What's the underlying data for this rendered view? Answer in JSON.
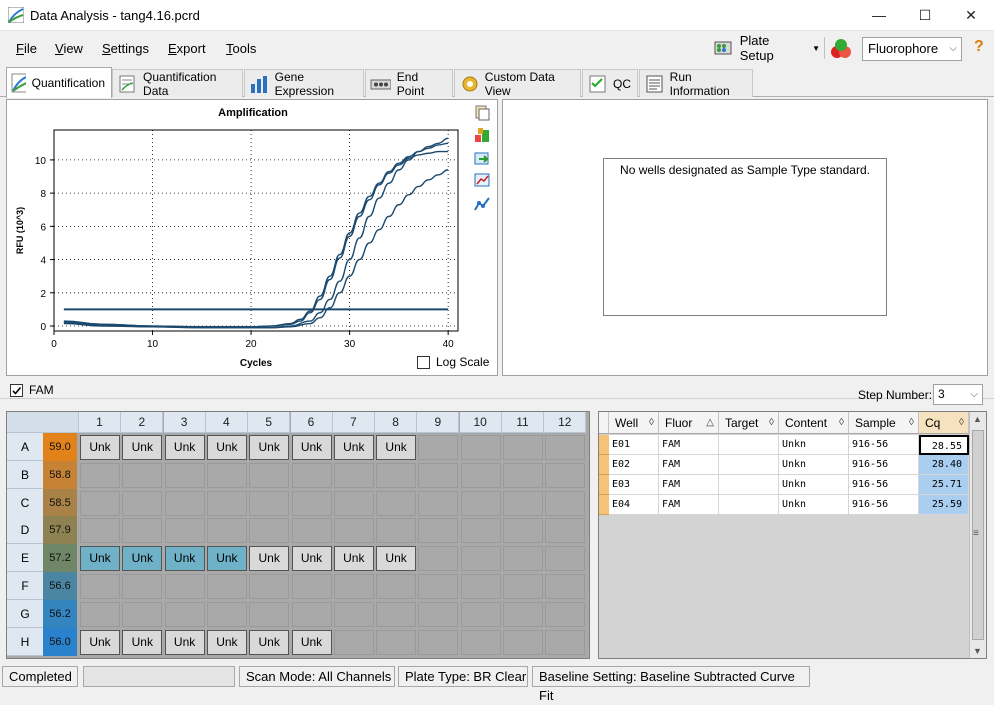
{
  "window": {
    "title": "Data Analysis - tang4.16.pcrd",
    "minimize": "—",
    "maximize": "☐",
    "close": "✕"
  },
  "menu": {
    "file": "File",
    "view": "View",
    "settings": "Settings",
    "export": "Export",
    "tools": "Tools"
  },
  "toolbar": {
    "plate_setup": "Plate Setup",
    "fluorophore": "Fluorophore",
    "help": "?"
  },
  "tabs": [
    "Quantification",
    "Quantification Data",
    "Gene Expression",
    "End Point",
    "Custom Data View",
    "QC",
    "Run Information"
  ],
  "chart_data": {
    "type": "line",
    "title": "Amplification",
    "xlabel": "Cycles",
    "ylabel": "RFU (10^3)",
    "xlim": [
      0,
      41
    ],
    "ylim": [
      -0.3,
      11.8
    ],
    "xticks": [
      0,
      10,
      20,
      30,
      40
    ],
    "yticks": [
      0,
      2,
      4,
      6,
      8,
      10
    ],
    "grid": true,
    "threshold": 1.0,
    "series": [
      {
        "x": [
          1,
          5,
          10,
          15,
          20,
          22,
          24,
          25,
          26,
          27,
          28,
          29,
          30,
          31,
          32,
          33,
          34,
          35,
          36,
          37,
          38,
          39,
          40
        ],
        "y": [
          0.3,
          0.1,
          0.0,
          -0.05,
          -0.05,
          0.0,
          0.15,
          0.4,
          0.9,
          1.8,
          3.0,
          4.3,
          5.6,
          6.8,
          7.8,
          8.6,
          9.3,
          9.8,
          10.2,
          10.5,
          10.7,
          10.9,
          11.0
        ]
      },
      {
        "x": [
          1,
          5,
          10,
          15,
          20,
          22,
          24,
          25,
          26,
          27,
          28,
          29,
          30,
          31,
          32,
          33,
          34,
          35,
          36,
          37,
          38,
          39,
          40
        ],
        "y": [
          0.25,
          0.1,
          0.0,
          -0.05,
          -0.05,
          0.0,
          0.1,
          0.3,
          0.8,
          1.6,
          2.8,
          4.1,
          5.4,
          6.6,
          7.6,
          8.5,
          9.2,
          9.7,
          10.1,
          10.3,
          10.4,
          10.5,
          10.5
        ]
      },
      {
        "x": [
          1,
          5,
          10,
          15,
          20,
          22,
          24,
          26,
          27,
          28,
          29,
          30,
          31,
          32,
          33,
          34,
          35,
          36,
          37,
          38,
          39,
          40
        ],
        "y": [
          0.2,
          0.05,
          -0.05,
          -0.1,
          -0.1,
          -0.1,
          0.0,
          0.3,
          0.8,
          1.6,
          2.7,
          4.0,
          5.3,
          6.6,
          7.7,
          8.6,
          9.4,
          10.0,
          10.5,
          10.8,
          11.0,
          11.3
        ]
      },
      {
        "x": [
          1,
          5,
          10,
          15,
          20,
          22,
          24,
          26,
          27,
          28,
          29,
          30,
          31,
          32,
          33,
          34,
          35,
          36,
          37,
          38,
          39,
          40
        ],
        "y": [
          0.15,
          0.0,
          -0.05,
          -0.1,
          -0.1,
          -0.1,
          -0.05,
          0.15,
          0.5,
          1.1,
          2.0,
          3.0,
          4.0,
          5.0,
          5.8,
          6.6,
          7.3,
          7.9,
          8.4,
          8.8,
          9.1,
          9.4
        ]
      }
    ]
  },
  "chart": {
    "log_scale": "Log Scale"
  },
  "standard_panel": {
    "message": "No wells designated as Sample Type standard."
  },
  "fluor_bar": {
    "fam_label": "FAM",
    "step_label": "Step Number:",
    "step_value": "3"
  },
  "plate": {
    "columns": [
      "1",
      "2",
      "3",
      "4",
      "5",
      "6",
      "7",
      "8",
      "9",
      "10",
      "11",
      "12"
    ],
    "rows": [
      {
        "label": "A",
        "temp": "59.0",
        "color": "#e1821a",
        "wells": [
          "Unk",
          "Unk",
          "Unk",
          "Unk",
          "Unk",
          "Unk",
          "Unk",
          "Unk"
        ],
        "selected": [
          false,
          false,
          false,
          false,
          false,
          false,
          false,
          false
        ]
      },
      {
        "label": "B",
        "temp": "58.8",
        "color": "#c68335",
        "wells": [],
        "selected": []
      },
      {
        "label": "C",
        "temp": "58.5",
        "color": "#a88246",
        "wells": [],
        "selected": []
      },
      {
        "label": "D",
        "temp": "57.9",
        "color": "#8e8252",
        "wells": [],
        "selected": []
      },
      {
        "label": "E",
        "temp": "57.2",
        "color": "#6f8667",
        "wells": [
          "Unk",
          "Unk",
          "Unk",
          "Unk",
          "Unk",
          "Unk",
          "Unk",
          "Unk"
        ],
        "selected": [
          true,
          true,
          true,
          true,
          false,
          false,
          false,
          false
        ]
      },
      {
        "label": "F",
        "temp": "56.6",
        "color": "#4a86a3",
        "wells": [],
        "selected": []
      },
      {
        "label": "G",
        "temp": "56.2",
        "color": "#3484c0",
        "wells": [],
        "selected": []
      },
      {
        "label": "H",
        "temp": "56.0",
        "color": "#2b82cc",
        "wells": [
          "Unk",
          "Unk",
          "Unk",
          "Unk",
          "Unk",
          "Unk"
        ],
        "selected": [
          false,
          false,
          false,
          false,
          false,
          false
        ]
      }
    ]
  },
  "table": {
    "headers": [
      "Well",
      "Fluor",
      "Target",
      "Content",
      "Sample",
      "Cq"
    ],
    "rows": [
      [
        "E01",
        "FAM",
        "",
        "Unkn",
        "916-56",
        "28.55"
      ],
      [
        "E02",
        "FAM",
        "",
        "Unkn",
        "916-56",
        "28.40"
      ],
      [
        "E03",
        "FAM",
        "",
        "Unkn",
        "916-56",
        "25.71"
      ],
      [
        "E04",
        "FAM",
        "",
        "Unkn",
        "916-56",
        "25.59"
      ]
    ]
  },
  "status": {
    "state": "Completed",
    "scan_mode": "Scan Mode: All Channels",
    "plate_type": "Plate Type: BR Clear",
    "baseline": "Baseline Setting: Baseline Subtracted Curve Fit"
  },
  "colors": {
    "accent": "#0078d7",
    "curve": "#1c4a6e",
    "selected_well": "#6fb2c8",
    "cq_cell": "#a9cef0"
  }
}
